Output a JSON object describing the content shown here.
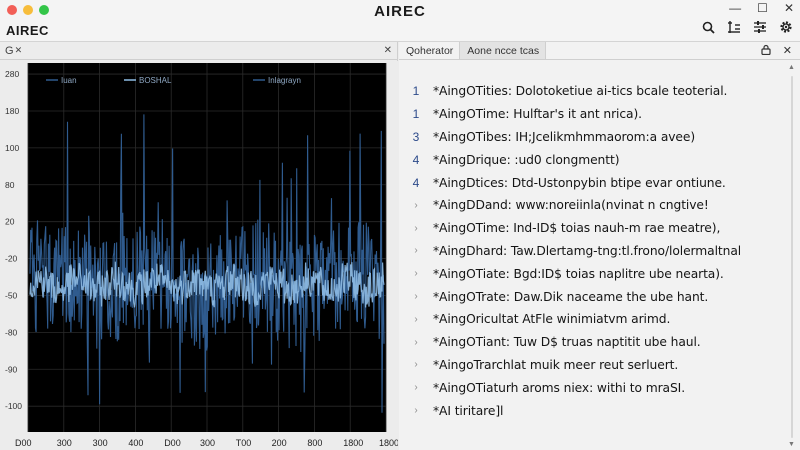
{
  "window": {
    "title": "AIREC",
    "app_name": "AIREC",
    "controls": [
      "—",
      "☐",
      "✕"
    ]
  },
  "toolbar": {
    "icons": [
      "search-icon",
      "filter-icon",
      "sliders-icon",
      "gear-icon"
    ]
  },
  "left_panel": {
    "tab_label": "G",
    "close_symbol": "✕",
    "close_symbol_right": "✕"
  },
  "right_panel": {
    "tabs": [
      "Qoherator",
      "Aone ncce tcas"
    ],
    "active_tab": 1,
    "log": [
      {
        "marker": "1",
        "text": "*AingOTities: Dolotoketiue ai-tics bcale teoterial."
      },
      {
        "marker": "1",
        "text": "*AingOTime: Hulftar's it ant nrica)."
      },
      {
        "marker": "3",
        "text": "*AingOTibes: IH;Jcelikmhmmaorom:a avee)"
      },
      {
        "marker": "4",
        "text": "*AingDrique: :ud0 clongmentt)"
      },
      {
        "marker": "4",
        "text": "*AingDtices: Dtd-Ustonpybin btipe evar ontiune."
      },
      {
        "marker": "›",
        "text": "*AingDDand: www:noreiinla(nvinat n cngtive!"
      },
      {
        "marker": "›",
        "text": "*AingOTime: Ind-ID$ toias nauh-m rae meatre),"
      },
      {
        "marker": "›",
        "text": "*AingDhard: Taw.Dlertamg-tng:tl.frono/lolermaltnal"
      },
      {
        "marker": "›",
        "text": "*AingOTiate: Bgd:ID$ toias naplitre ube nearta)."
      },
      {
        "marker": "›",
        "text": "*AingOTrate: Daw.Dik naceame the ube hant."
      },
      {
        "marker": "›",
        "text": "*AingOricultat AtFle winimiatvm arimd."
      },
      {
        "marker": "›",
        "text": "*AingOTiant: Tuw D$ truas naptitit ube haul."
      },
      {
        "marker": "›",
        "text": "*AingoTrarchlat muik meer reut serluert."
      },
      {
        "marker": "›",
        "text": "*AingOTiaturh aroms niex: withi to mraSI."
      },
      {
        "marker": "›",
        "text": "*AI tiritare]l"
      }
    ]
  },
  "colors": {
    "plot_bg": "#000000",
    "signal_dark": "#2f5b8e",
    "signal_light": "#8fbde6",
    "grid": "#2b2b2b",
    "log_number": "#2c4a8a"
  },
  "chart_data": {
    "type": "line",
    "title": "",
    "xlabel": "",
    "ylabel": "",
    "xlim": [
      0,
      1900
    ],
    "ylim": [
      -100,
      200
    ],
    "grid": true,
    "legend_position": "top",
    "legend": [
      "Iuan",
      "BOSHAL",
      "Inlagrayn"
    ],
    "x_ticks": [
      "D00",
      "300",
      "300",
      "400",
      "D00",
      "300",
      "T00",
      "200",
      "800",
      "1800",
      "1800"
    ],
    "y_ticks": [
      "280",
      "180",
      "100",
      "80",
      "20",
      "-20",
      "-50",
      "-80",
      "-90",
      "-100"
    ],
    "series": [
      {
        "name": "Iuan",
        "description_values": {
          "center": 20,
          "typical_amplitude": 45,
          "max": 160,
          "min": -80
        }
      },
      {
        "name": "BOSHAL",
        "description_values": {
          "center": 20,
          "typical_amplitude": 15
        }
      }
    ]
  }
}
